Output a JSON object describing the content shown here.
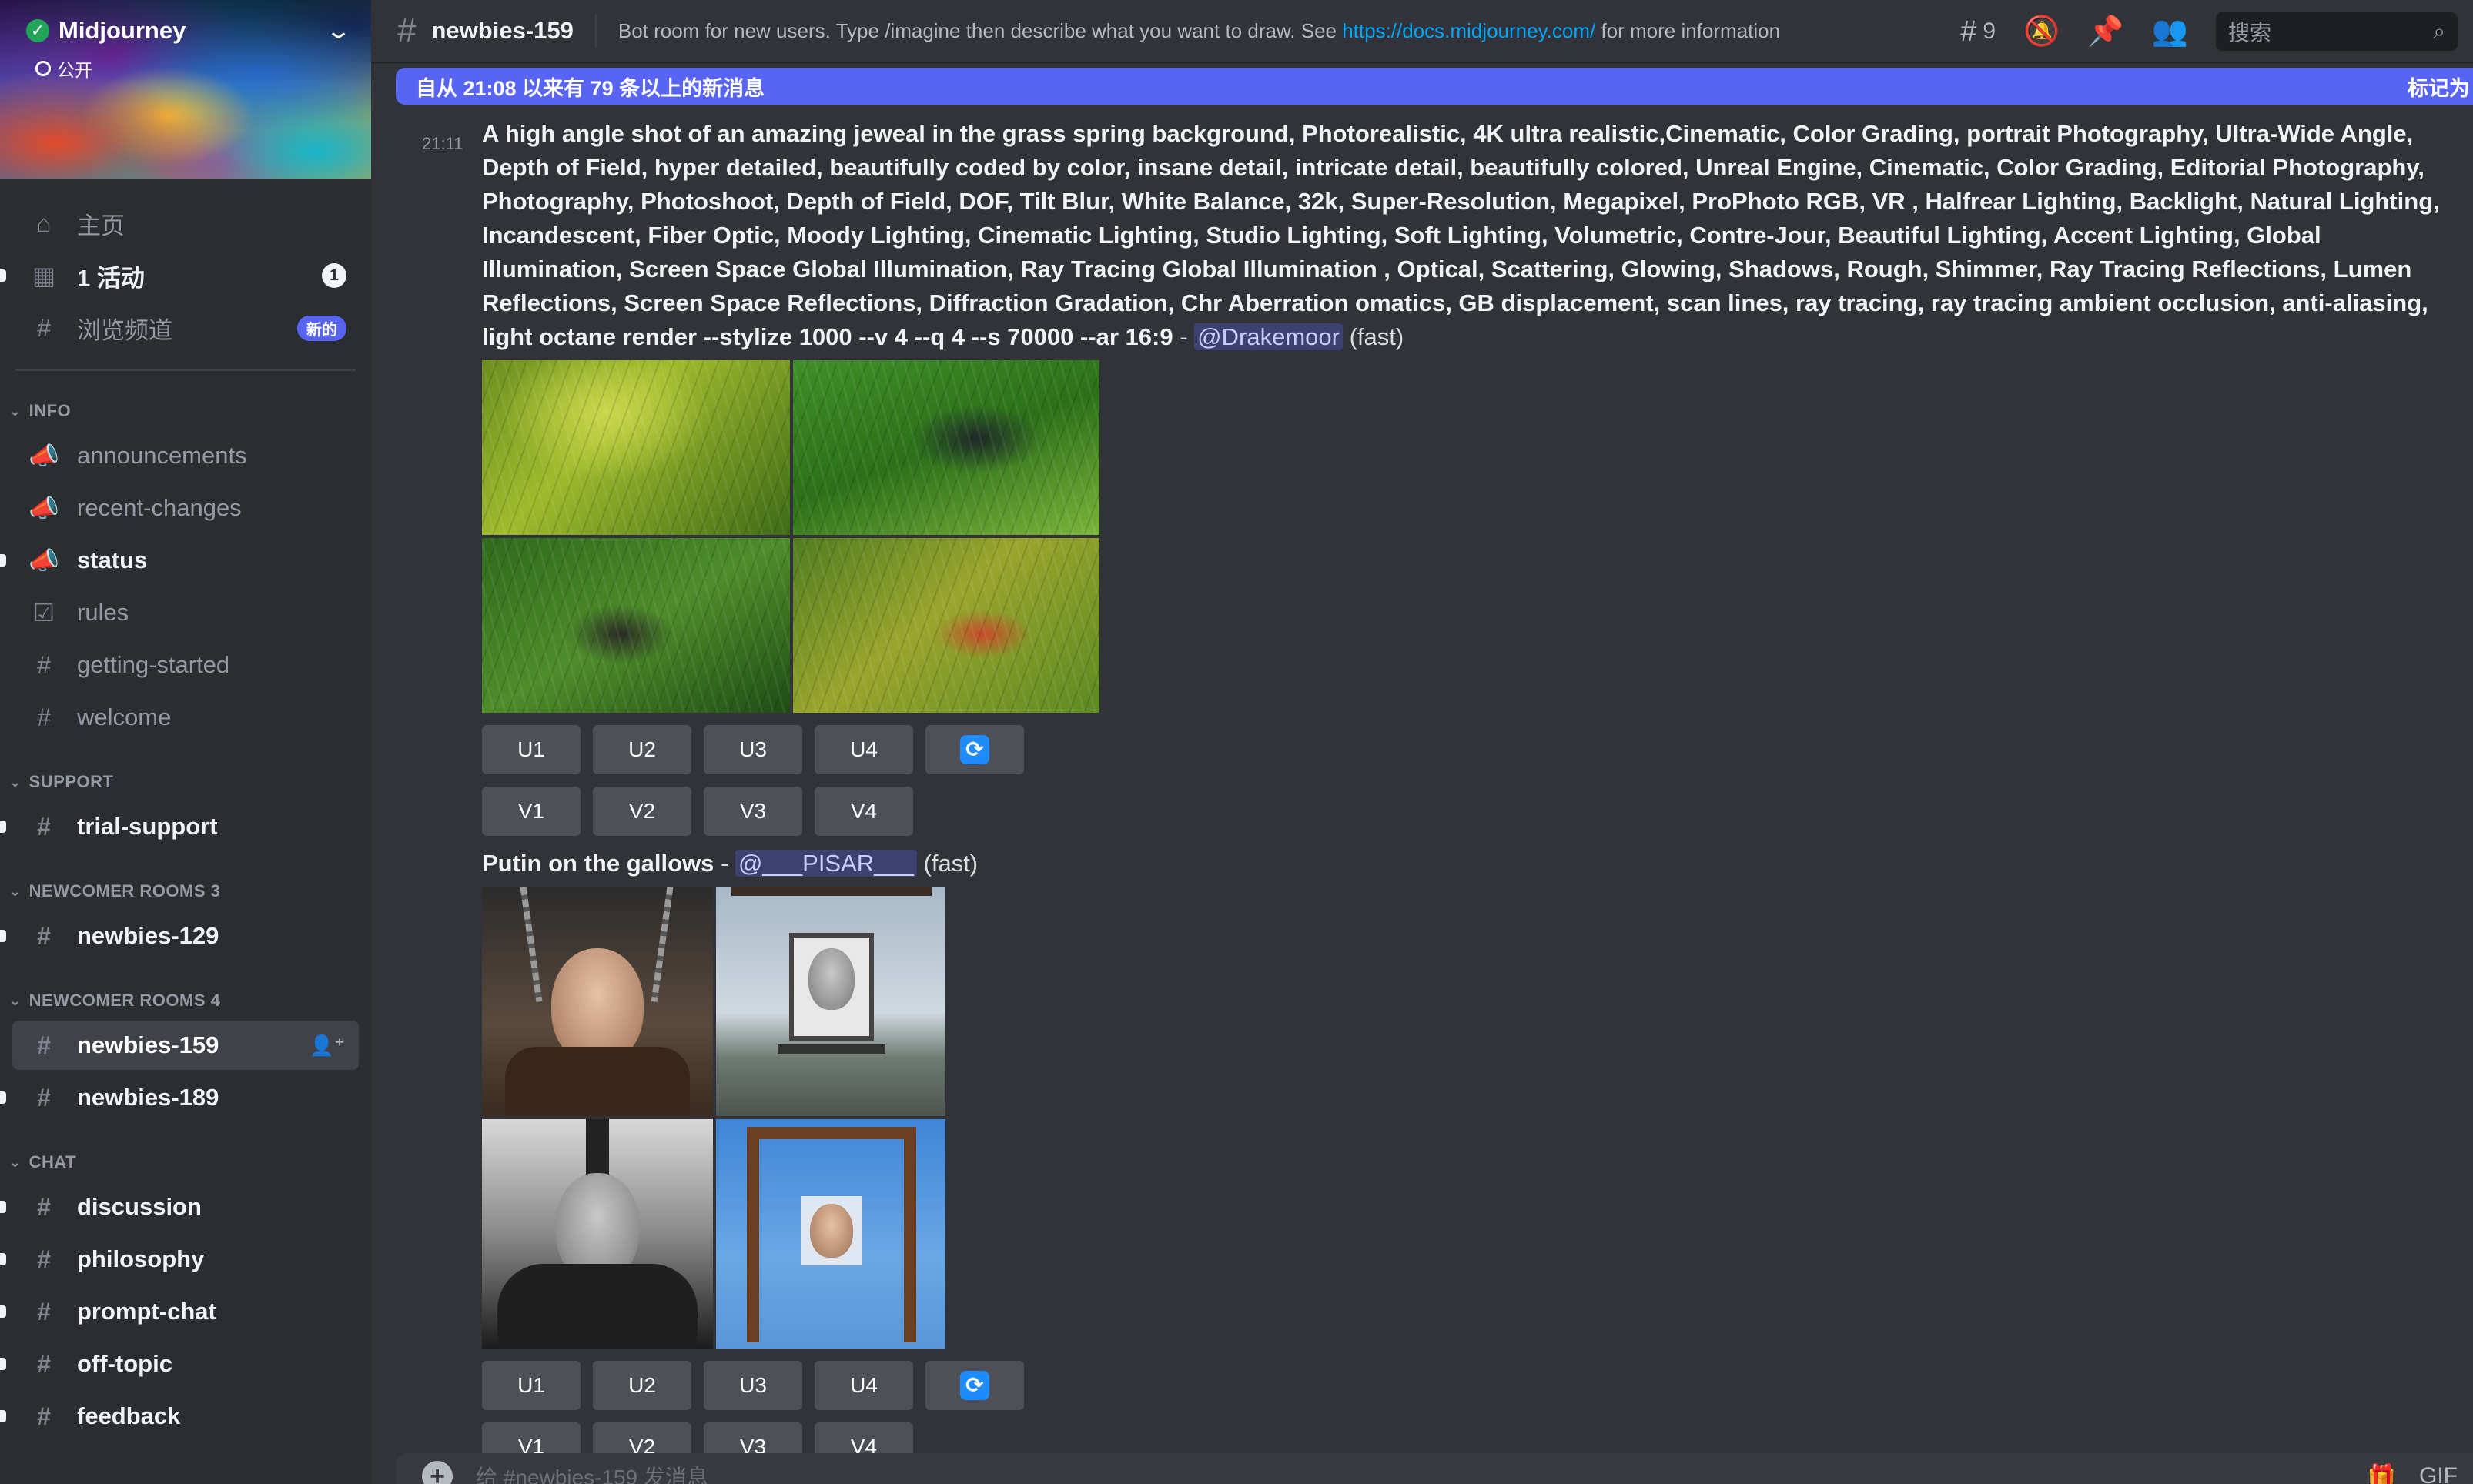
{
  "server": {
    "name": "Midjourney",
    "visibility": "公开"
  },
  "nav": {
    "home": "主页",
    "events": "1 活动",
    "events_badge": "1",
    "browse": "浏览频道",
    "browse_badge": "新的"
  },
  "categories": {
    "info": "INFO",
    "support": "SUPPORT",
    "newcomer3": "NEWCOMER ROOMS 3",
    "newcomer4": "NEWCOMER ROOMS 4",
    "chat": "CHAT"
  },
  "channels": {
    "announcements": "announcements",
    "recent_changes": "recent-changes",
    "status": "status",
    "rules": "rules",
    "getting_started": "getting-started",
    "welcome": "welcome",
    "trial_support": "trial-support",
    "newbies_129": "newbies-129",
    "newbies_159": "newbies-159",
    "newbies_189": "newbies-189",
    "discussion": "discussion",
    "philosophy": "philosophy",
    "prompt_chat": "prompt-chat",
    "off_topic": "off-topic",
    "feedback": "feedback"
  },
  "header": {
    "channel": "newbies-159",
    "topic_before": "Bot room for new users. Type /imagine then describe what you want to draw. See ",
    "topic_link": "https://docs.midjourney.com/",
    "topic_after": " for more information",
    "thread_count": "9",
    "search_placeholder": "搜索"
  },
  "new_messages_bar": {
    "text": "自从 21:08 以来有 79 条以上的新消息",
    "mark_read": "标记为"
  },
  "messages": [
    {
      "time": "21:11",
      "prompt": "A high angle shot of an amazing jeweal in the grass spring background, Photorealistic, 4K ultra realistic,Cinematic, Color Grading, portrait Photography, Ultra-Wide Angle, Depth of Field, hyper detailed, beautifully coded by color, insane detail, intricate detail, beautifully colored, Unreal Engine, Cinematic, Color Grading, Editorial Photography, Photography, Photoshoot, Depth of Field, DOF, Tilt Blur, White Balance, 32k, Super-Resolution, Megapixel, ProPhoto RGB, VR , Halfrear Lighting, Backlight, Natural Lighting, Incandescent, Fiber Optic, Moody Lighting, Cinematic Lighting, Studio Lighting, Soft Lighting, Volumetric, Contre-Jour, Beautiful Lighting, Accent Lighting, Global Illumination, Screen Space Global Illumination, Ray Tracing Global Illumination , Optical, Scattering, Glowing, Shadows, Rough, Shimmer, Ray Tracing Reflections, Lumen Reflections, Screen Space Reflections, Diffraction Gradation, Chr Aberration omatics, GB displacement, scan lines, ray tracing, ray tracing ambient occlusion, anti-aliasing, light octane render --stylize 1000 --v 4 --q 4 --s 70000 --ar 16:9",
      "dash": " - ",
      "mention": "@Drakemoor",
      "speed": " (fast)"
    },
    {
      "prompt": "Putin on the gallows",
      "dash": " - ",
      "mention": "@___PISAR___",
      "speed": " (fast)"
    }
  ],
  "buttons": {
    "u1": "U1",
    "u2": "U2",
    "u3": "U3",
    "u4": "U4",
    "v1": "V1",
    "v2": "V2",
    "v3": "V3",
    "v4": "V4"
  },
  "composer": {
    "placeholder": "给 #newbies-159 发消息"
  },
  "colors": {
    "accent": "#5865f2",
    "link": "#00a8fc",
    "online": "#23a559"
  }
}
